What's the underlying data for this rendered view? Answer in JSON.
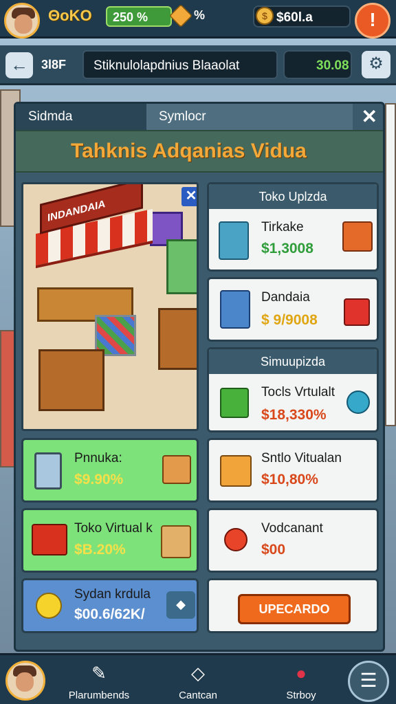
{
  "topbar": {
    "username": "ΘoKO",
    "pct": "250 %",
    "pct_symbol": "%",
    "money": "$60l.a",
    "alert": "!"
  },
  "nav": {
    "back": "←",
    "code": "3l8F",
    "title": "Stiknulolapdnius Blaaolat",
    "bag_value": "30.08",
    "settings": "⚙"
  },
  "panel": {
    "tabs": [
      "Sidmda",
      "Symlocr"
    ],
    "close": "✕",
    "header": "Tahknis Adqanias Vidua",
    "shop_sign": "INDANDAIA",
    "shop_close": "✕",
    "right_top_header": "Toko Uplzda",
    "item1": {
      "title": "Tirkake",
      "value": "$1,3008"
    },
    "item2": {
      "title": "Dandaia",
      "value": "$ 9/9008"
    },
    "right_mid_header": "Simuupizda",
    "item3": {
      "title": "Tocls Vrtulalt",
      "value": "$18,330%"
    },
    "item4": {
      "title": "Pnnuka:",
      "value": "$9.90%"
    },
    "item5": {
      "title": "Sntlo Vitualan",
      "value": "$10,80%"
    },
    "item6": {
      "title": "Toko Virtual k",
      "value": "$B.20%"
    },
    "item7": {
      "title": "Vodcanant",
      "value": "$00"
    },
    "item8": {
      "title": "Sydan krdula",
      "value": "$00.6/62K/"
    },
    "arrow": "◆",
    "upgrade": "UPECARDO"
  },
  "bottom": {
    "items": [
      {
        "label": "Plarumbends",
        "icon": "✎"
      },
      {
        "label": "Cantcan",
        "icon": "◇"
      },
      {
        "label": "Strboy",
        "icon": "●"
      }
    ],
    "menu": "☰"
  },
  "colors": {
    "accent": "#f2a93a",
    "price_green": "#2f9d3a",
    "price_orange": "#e07a12",
    "price_red": "#d9481b"
  }
}
